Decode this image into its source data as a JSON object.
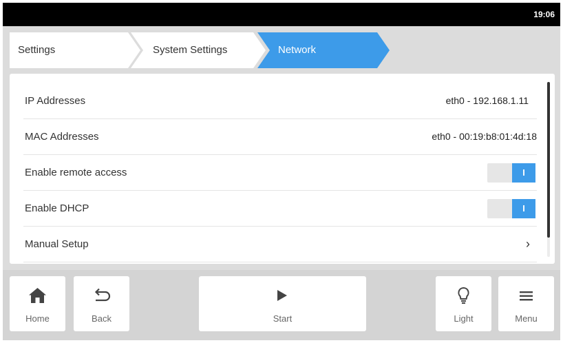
{
  "status_bar": {
    "time": "19:06"
  },
  "breadcrumb": [
    {
      "label": "Settings"
    },
    {
      "label": "System Settings"
    },
    {
      "label": "Network"
    }
  ],
  "network": {
    "rows": [
      {
        "label": "IP Addresses",
        "value": "eth0 - 192.168.1.11"
      },
      {
        "label": "MAC Addresses",
        "value": "eth0 - 00:19:b8:01:4d:18"
      },
      {
        "label": "Enable remote access",
        "toggle": "I",
        "enabled": true
      },
      {
        "label": "Enable DHCP",
        "toggle": "I",
        "enabled": true
      },
      {
        "label": "Manual Setup",
        "chevron": "›"
      }
    ]
  },
  "toolbar": {
    "home": {
      "label": "Home",
      "icon": "home-icon"
    },
    "back": {
      "label": "Back",
      "icon": "back-arrow-icon"
    },
    "start": {
      "label": "Start",
      "icon": "play-icon"
    },
    "light": {
      "label": "Light",
      "icon": "lightbulb-icon"
    },
    "menu": {
      "label": "Menu",
      "icon": "hamburger-menu-icon"
    }
  },
  "colors": {
    "accent": "#3d9be9",
    "status_bar": "#000000",
    "background": "#dcdcdc",
    "panel": "#ffffff"
  }
}
